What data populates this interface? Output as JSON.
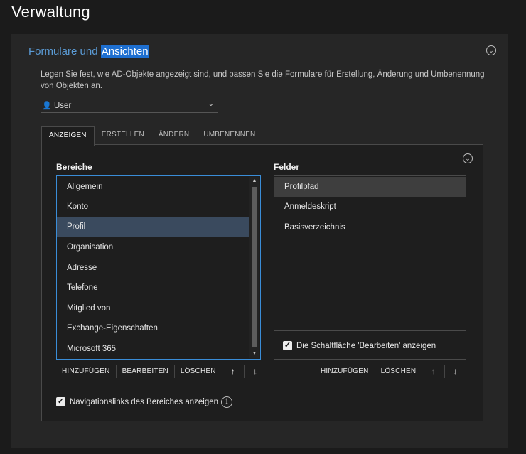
{
  "page": {
    "title": "Verwaltung"
  },
  "section": {
    "title_part1": "Formulare und ",
    "title_part2": "Ansichten",
    "description": "Legen Sie fest, wie AD-Objekte angezeigt sind, und passen Sie die Formulare für Erstellung, Änderung und Umbenennung von Objekten an.",
    "object_type": {
      "selected": "User",
      "icon": "user-icon"
    }
  },
  "tabs": [
    {
      "label": "ANZEIGEN",
      "active": true
    },
    {
      "label": "ERSTELLEN",
      "active": false
    },
    {
      "label": "ÄNDERN",
      "active": false
    },
    {
      "label": "UMBENENNEN",
      "active": false
    }
  ],
  "areas": {
    "heading": "Bereiche",
    "selected_index": 2,
    "items": [
      "Allgemein",
      "Konto",
      "Profil",
      "Organisation",
      "Adresse",
      "Telefone",
      "Mitglied von",
      "Exchange-Eigenschaften",
      "Microsoft 365"
    ],
    "buttons": {
      "add": "HINZUFÜGEN",
      "edit": "BEARBEITEN",
      "delete": "LÖSCHEN",
      "up": "↑",
      "down": "↓"
    }
  },
  "fields": {
    "heading": "Felder",
    "selected_index": 0,
    "items": [
      "Profilpfad",
      "Anmeldeskript",
      "Basisverzeichnis"
    ],
    "show_edit_button": {
      "label": "Die Schaltfläche 'Bearbeiten' anzeigen",
      "checked": true
    },
    "buttons": {
      "add": "HINZUFÜGEN",
      "delete": "LÖSCHEN",
      "up": "↑",
      "down": "↓"
    }
  },
  "nav_links": {
    "label": "Navigationslinks des Bereiches anzeigen",
    "checked": true
  },
  "colors": {
    "accent": "#5b9bd5",
    "selection": "#1e6fd0",
    "list_border": "#3a8dd8"
  }
}
